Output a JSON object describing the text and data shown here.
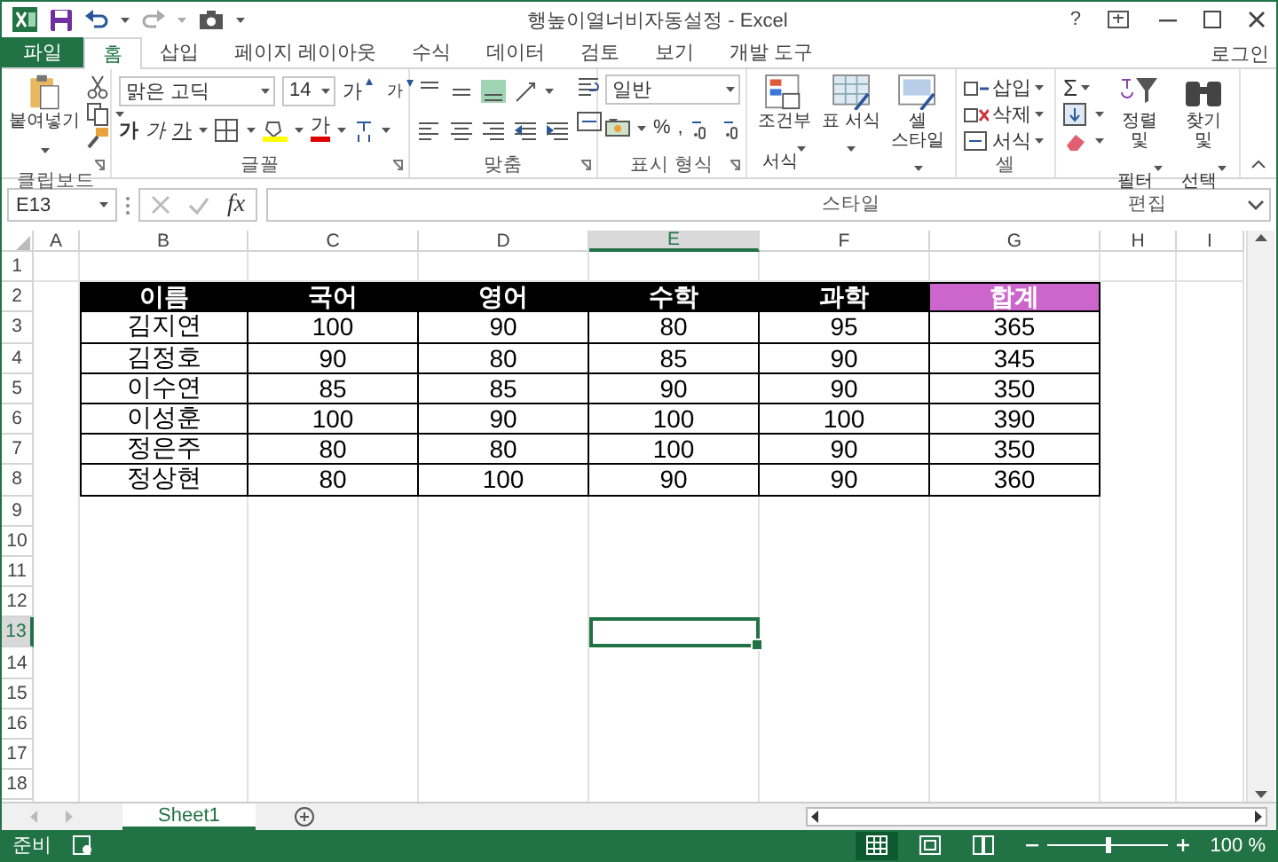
{
  "window": {
    "title": "행높이열너비자동설정 - Excel",
    "help": "?"
  },
  "ribbon_tabs": [
    {
      "label": "파일",
      "kind": "file",
      "selected": false
    },
    {
      "label": "홈",
      "kind": "tab",
      "selected": true
    },
    {
      "label": "삽입",
      "kind": "tab",
      "selected": false
    },
    {
      "label": "페이지 레이아웃",
      "kind": "tab",
      "selected": false
    },
    {
      "label": "수식",
      "kind": "tab",
      "selected": false
    },
    {
      "label": "데이터",
      "kind": "tab",
      "selected": false
    },
    {
      "label": "검토",
      "kind": "tab",
      "selected": false
    },
    {
      "label": "보기",
      "kind": "tab",
      "selected": false
    },
    {
      "label": "개발 도구",
      "kind": "tab",
      "selected": false
    }
  ],
  "account": "로그인",
  "clipboard": {
    "paste": "붙여넣기",
    "group": "클립보드"
  },
  "font": {
    "name": "맑은 고딕",
    "size": "14",
    "grow": "가",
    "shrink": "가",
    "styles": [
      {
        "label": "가",
        "kind": "bold"
      },
      {
        "label": "가",
        "kind": "italic"
      },
      {
        "label": "가",
        "kind": "underline"
      }
    ],
    "font_color": "가",
    "group": "글꼴"
  },
  "alignment": {
    "vertical": [
      {
        "kind": "top",
        "selected": false
      },
      {
        "kind": "middle",
        "selected": false
      },
      {
        "kind": "bottom",
        "selected": true
      }
    ],
    "group": "맞춤"
  },
  "number": {
    "format": "일반",
    "percent": "%",
    "comma": ",",
    "group": "표시 형식"
  },
  "styles": {
    "buttons": [
      {
        "label": "조건부 서식",
        "kind": "conditional"
      },
      {
        "label": "표 서식",
        "kind": "table"
      },
      {
        "label": "셀 스타일",
        "kind": "cell"
      }
    ],
    "group": "스타일"
  },
  "cells": {
    "buttons": [
      {
        "label": "삽입",
        "kind": "insert"
      },
      {
        "label": "삭제",
        "kind": "delete"
      },
      {
        "label": "서식",
        "kind": "format"
      }
    ],
    "group": "셀"
  },
  "editing": {
    "sum": "Σ",
    "buttons": [
      {
        "label": "정렬 및 필터",
        "kind": "sort"
      },
      {
        "label": "찾기 및 선택",
        "kind": "find"
      }
    ],
    "group": "편집"
  },
  "formula_bar": {
    "name_box": "E13",
    "function": "fx"
  },
  "sheet": {
    "columns": [
      {
        "label": "A",
        "selected": false
      },
      {
        "label": "B",
        "selected": false
      },
      {
        "label": "C",
        "selected": false
      },
      {
        "label": "D",
        "selected": false
      },
      {
        "label": "E",
        "selected": true
      },
      {
        "label": "F",
        "selected": false
      },
      {
        "label": "G",
        "selected": false
      },
      {
        "label": "H",
        "selected": false
      },
      {
        "label": "I",
        "selected": false
      }
    ],
    "rows": [
      {
        "label": "1",
        "selected": false
      },
      {
        "label": "2",
        "selected": false
      },
      {
        "label": "3",
        "selected": false
      },
      {
        "label": "4",
        "selected": false
      },
      {
        "label": "5",
        "selected": false
      },
      {
        "label": "6",
        "selected": false
      },
      {
        "label": "7",
        "selected": false
      },
      {
        "label": "8",
        "selected": false
      },
      {
        "label": "9",
        "selected": false
      },
      {
        "label": "10",
        "selected": false
      },
      {
        "label": "11",
        "selected": false
      },
      {
        "label": "12",
        "selected": false
      },
      {
        "label": "13",
        "selected": true
      },
      {
        "label": "14",
        "selected": false
      },
      {
        "label": "15",
        "selected": false
      },
      {
        "label": "16",
        "selected": false
      },
      {
        "label": "17",
        "selected": false
      },
      {
        "label": "18",
        "selected": false
      }
    ],
    "table": {
      "header": [
        {
          "label": "이름",
          "color": "#000000"
        },
        {
          "label": "국어",
          "color": "#000000"
        },
        {
          "label": "영어",
          "color": "#000000"
        },
        {
          "label": "수학",
          "color": "#000000"
        },
        {
          "label": "과학",
          "color": "#000000"
        },
        {
          "label": "합계",
          "color": "#cc66cc"
        }
      ],
      "rows": [
        [
          "김지연",
          "100",
          "90",
          "80",
          "95",
          "365"
        ],
        [
          "김정호",
          "90",
          "80",
          "85",
          "90",
          "345"
        ],
        [
          "이수연",
          "85",
          "85",
          "90",
          "90",
          "350"
        ],
        [
          "이성훈",
          "100",
          "90",
          "100",
          "100",
          "390"
        ],
        [
          "정은주",
          "80",
          "80",
          "100",
          "90",
          "350"
        ],
        [
          "정상현",
          "80",
          "100",
          "90",
          "90",
          "360"
        ]
      ]
    }
  },
  "sheet_tabs": [
    {
      "label": "Sheet1",
      "selected": true
    }
  ],
  "status_bar": {
    "status": "준비",
    "views": [
      {
        "kind": "normal",
        "selected": true
      },
      {
        "kind": "layout",
        "selected": false
      },
      {
        "kind": "break",
        "selected": false
      }
    ],
    "zoom": "100 %",
    "level": 0.5
  }
}
